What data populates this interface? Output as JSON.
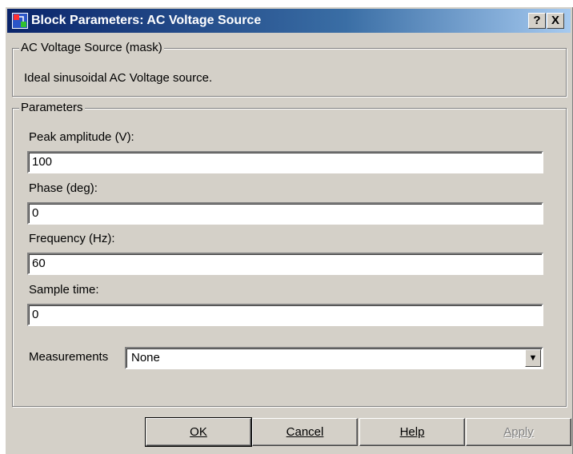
{
  "window": {
    "title": "Block Parameters: AC Voltage Source",
    "help_glyph": "?",
    "close_glyph": "X"
  },
  "mask_group": {
    "legend": "AC Voltage Source (mask)",
    "description": "Ideal sinusoidal AC Voltage source."
  },
  "params_group": {
    "legend": "Parameters",
    "fields": [
      {
        "label": "Peak amplitude (V):",
        "value": "100"
      },
      {
        "label": "Phase (deg):",
        "value": "0"
      },
      {
        "label": "Frequency (Hz):",
        "value": "60"
      },
      {
        "label": "Sample time:",
        "value": "0"
      }
    ],
    "measurements": {
      "label": "Measurements",
      "value": "None",
      "arrow": "▼"
    }
  },
  "buttons": {
    "ok": "OK",
    "cancel": "Cancel",
    "help": "Help",
    "apply": "Apply"
  },
  "colors": {
    "dialog_face": "#d4d0c8",
    "title_start": "#0a246a",
    "title_end": "#a6caf0"
  }
}
